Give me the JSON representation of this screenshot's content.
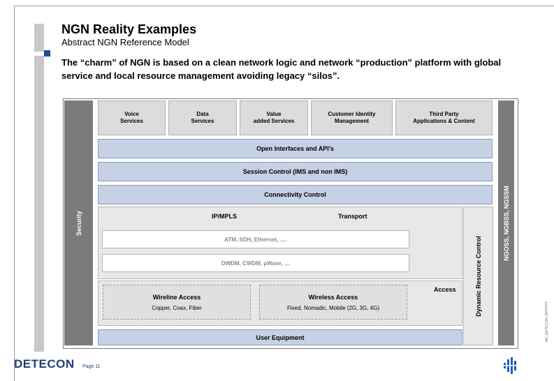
{
  "header": {
    "title": "NGN Reality Examples",
    "subtitle": "Abstract NGN Reference Model",
    "headline": "The “charm” of NGN is based on a clean network logic and network “production” platform with global service and local resource management avoiding legacy “silos”."
  },
  "diagram": {
    "security": "Security",
    "ngoss": "NGOSS, NGBSS, NGSSM",
    "services": [
      {
        "line1": "Voice",
        "line2": "Services"
      },
      {
        "line1": "Data",
        "line2": "Services"
      },
      {
        "line1": "Value",
        "line2": "added Services"
      },
      {
        "line1": "Customer Identity",
        "line2": "Management"
      },
      {
        "line1": "Third Party",
        "line2": "Applications & Content"
      }
    ],
    "open_interfaces": "Open Interfaces and API’s",
    "session_control": "Session Control (IMS and non IMS)",
    "connectivity_control": "Connectivity Control",
    "ip_mpls": "IP/MPLS",
    "transport": "Transport",
    "atm": "ATM, SDH, Ethernet, ….",
    "dwdm": "DWDM, CWDM, µWave, …",
    "access": "Access",
    "wireline_title": "Wireline Access",
    "wireline_sub": "Copper, Coax, Fiber",
    "wireless_title": "Wireless Access",
    "wireless_sub": "Fixed, Nomadic, Mobile (2G, 3G, 4G)",
    "dynamic_resource_control": "Dynamic Resource Control",
    "user_equipment": "User Equipment"
  },
  "footer": {
    "logo": "DETECON",
    "page": "Page 11",
    "file_note": "MK_DETECON_HPP.PPT"
  },
  "colors": {
    "band": "#c5d1e4",
    "side_bar": "#7b7b7b",
    "brand_blue": "#1f3f7a"
  }
}
